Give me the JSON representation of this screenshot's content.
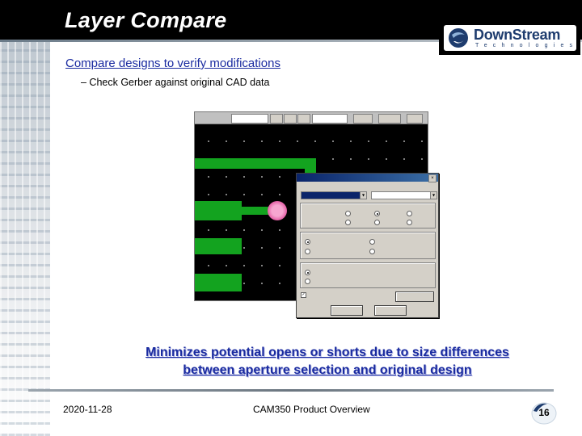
{
  "slide": {
    "title": "Layer Compare",
    "bullet_main": "Compare designs to verify modifications",
    "bullet_sub": "– Check Gerber against original CAD data",
    "caption_line1": "Minimizes potential opens or shorts due to size differences",
    "caption_line2": "between aperture selection and original design"
  },
  "logo": {
    "name": "DownStream",
    "tagline": "Technologies"
  },
  "footer": {
    "date": "2020-11-28",
    "center": "CAM350 Product Overview",
    "page": "16"
  },
  "colors": {
    "title_bar": "#000000",
    "title_text": "#ffffff",
    "link_blue": "#1a2ba0",
    "trace_green": "#13a31f",
    "pad_pink": "#e55fa6",
    "dialog_title": "#0a246a"
  }
}
